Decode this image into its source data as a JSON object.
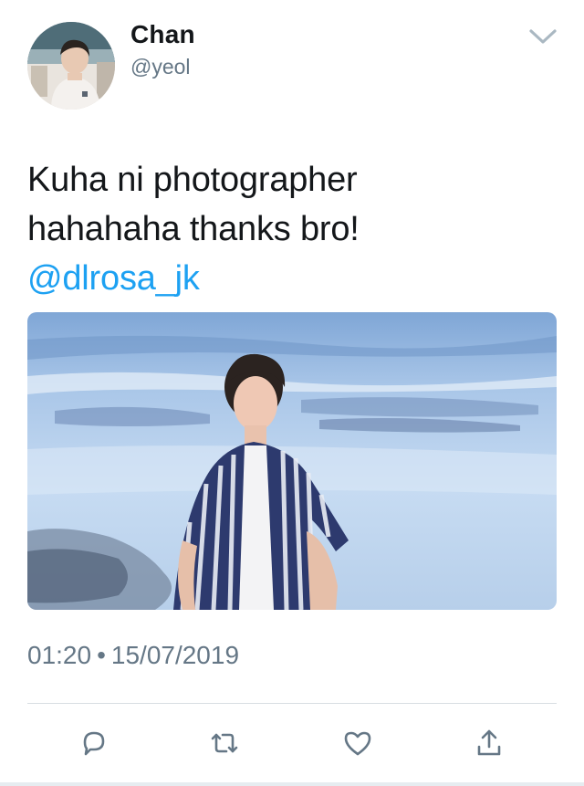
{
  "author": {
    "display_name": "Chan",
    "handle": "@yeol"
  },
  "tweet": {
    "text_line1": "Kuha ni photographer",
    "text_line2": "hahahaha thanks bro!",
    "mention": "@dlrosa_jk",
    "time": "01:20",
    "separator": "•",
    "date": "15/07/2019"
  },
  "icons": {
    "menu": "chevron-down-icon",
    "reply": "reply-icon",
    "retweet": "retweet-icon",
    "like": "heart-icon",
    "share": "share-icon"
  },
  "colors": {
    "text": "#14171a",
    "secondary": "#657786",
    "link": "#1da1f2",
    "divider": "#d8dee2"
  }
}
